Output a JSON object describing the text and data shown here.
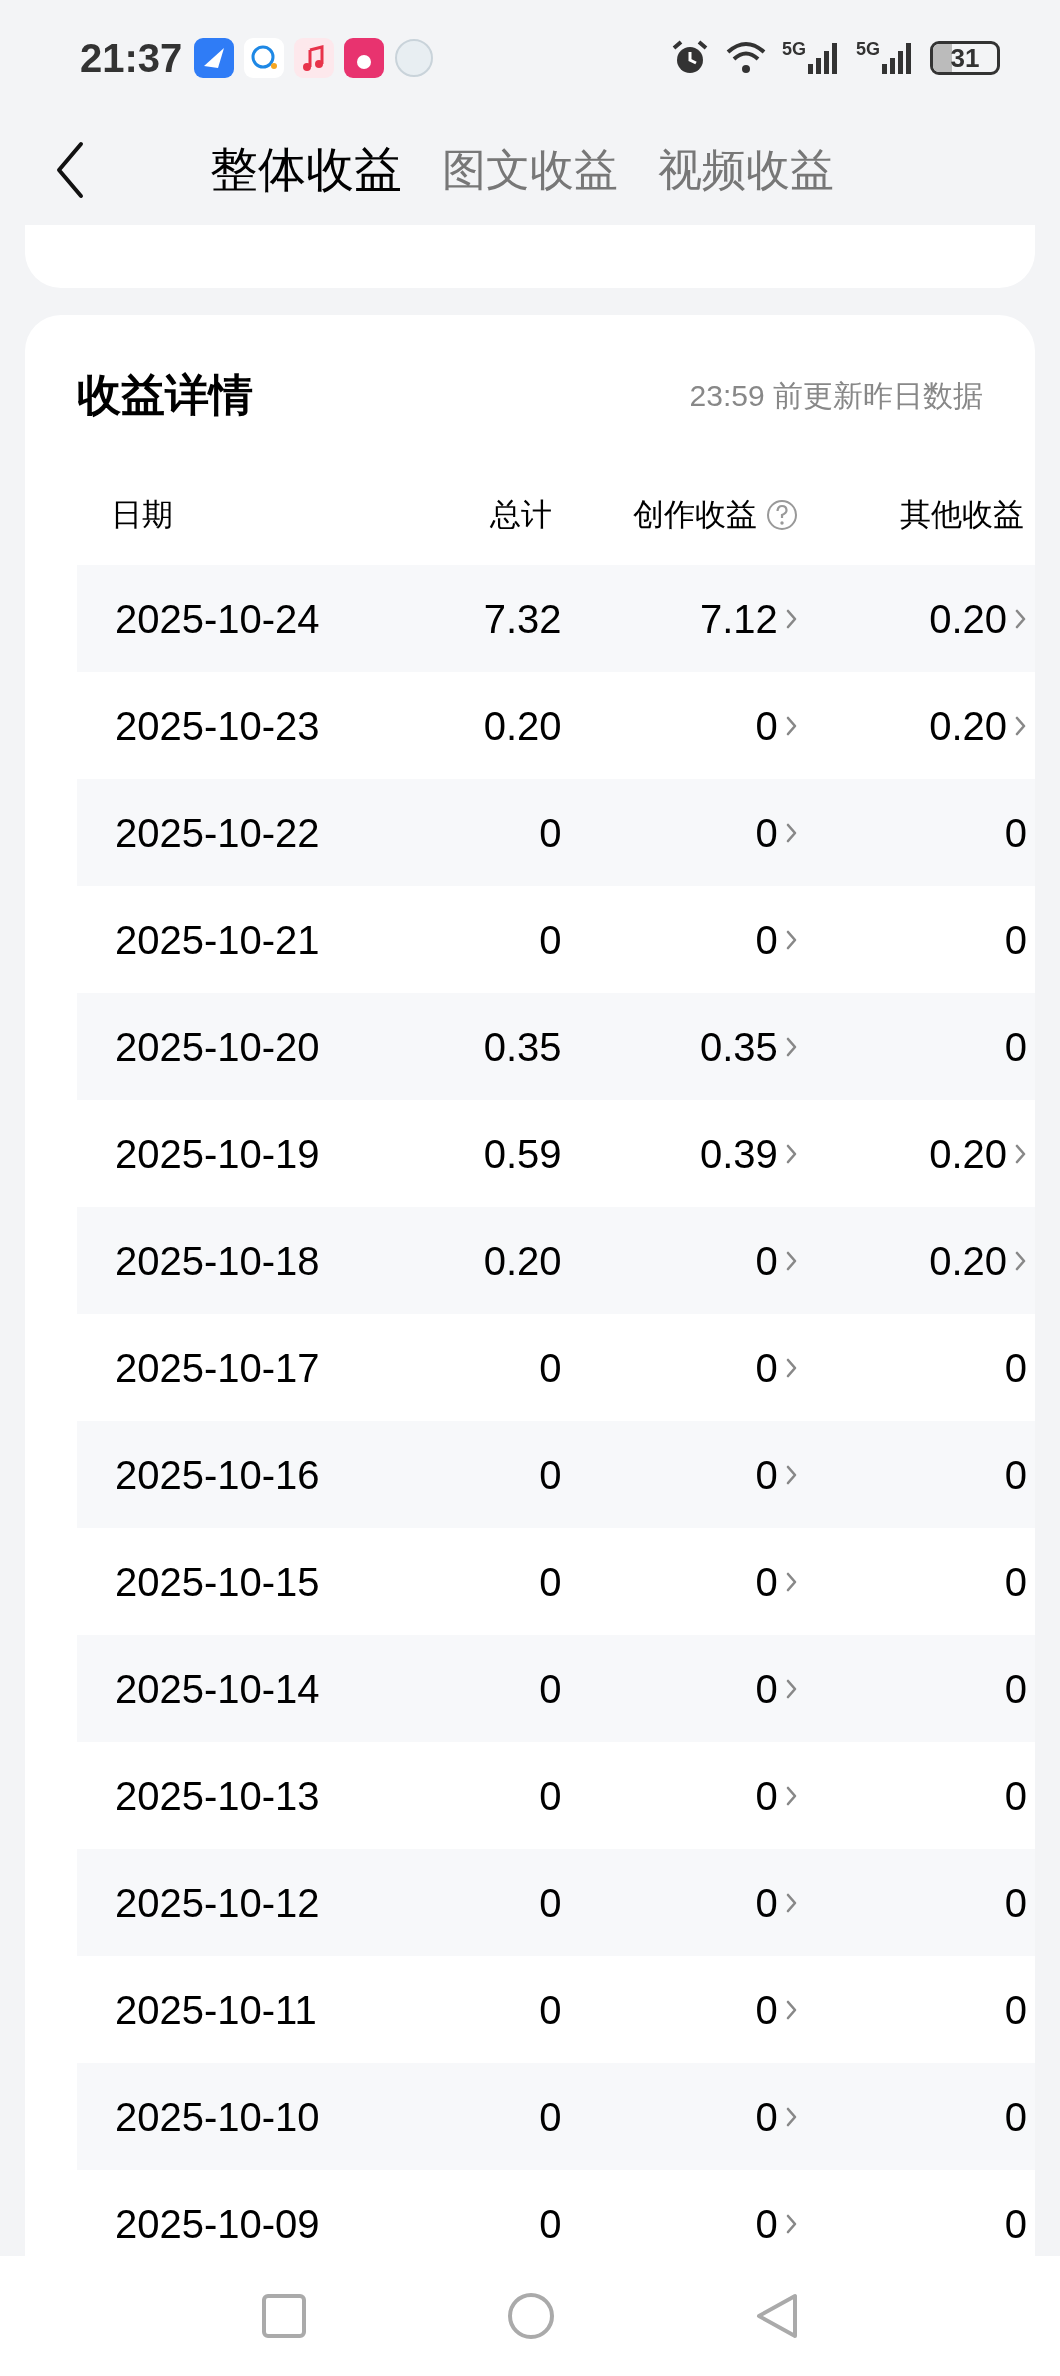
{
  "status_bar": {
    "time": "21:37",
    "networks": [
      {
        "label": "5G"
      },
      {
        "label": "5G"
      }
    ],
    "battery": "31"
  },
  "tabs": [
    {
      "label": "整体收益",
      "selected": true
    },
    {
      "label": "图文收益",
      "selected": false
    },
    {
      "label": "视频收益",
      "selected": false
    }
  ],
  "details": {
    "title": "收益详情",
    "note": "23:59 前更新昨日数据",
    "columns": [
      "日期",
      "总计",
      "创作收益",
      "其他收益"
    ],
    "rows": [
      {
        "date": "2025-10-24",
        "total": "7.32",
        "creation": "7.12",
        "other": "0.20",
        "other_link": true
      },
      {
        "date": "2025-10-23",
        "total": "0.20",
        "creation": "0",
        "other": "0.20",
        "other_link": true
      },
      {
        "date": "2025-10-22",
        "total": "0",
        "creation": "0",
        "other": "0",
        "other_link": false
      },
      {
        "date": "2025-10-21",
        "total": "0",
        "creation": "0",
        "other": "0",
        "other_link": false
      },
      {
        "date": "2025-10-20",
        "total": "0.35",
        "creation": "0.35",
        "other": "0",
        "other_link": false
      },
      {
        "date": "2025-10-19",
        "total": "0.59",
        "creation": "0.39",
        "other": "0.20",
        "other_link": true
      },
      {
        "date": "2025-10-18",
        "total": "0.20",
        "creation": "0",
        "other": "0.20",
        "other_link": true
      },
      {
        "date": "2025-10-17",
        "total": "0",
        "creation": "0",
        "other": "0",
        "other_link": false
      },
      {
        "date": "2025-10-16",
        "total": "0",
        "creation": "0",
        "other": "0",
        "other_link": false
      },
      {
        "date": "2025-10-15",
        "total": "0",
        "creation": "0",
        "other": "0",
        "other_link": false
      },
      {
        "date": "2025-10-14",
        "total": "0",
        "creation": "0",
        "other": "0",
        "other_link": false
      },
      {
        "date": "2025-10-13",
        "total": "0",
        "creation": "0",
        "other": "0",
        "other_link": false
      },
      {
        "date": "2025-10-12",
        "total": "0",
        "creation": "0",
        "other": "0",
        "other_link": false
      },
      {
        "date": "2025-10-11",
        "total": "0",
        "creation": "0",
        "other": "0",
        "other_link": false
      },
      {
        "date": "2025-10-10",
        "total": "0",
        "creation": "0",
        "other": "0",
        "other_link": false
      },
      {
        "date": "2025-10-09",
        "total": "0",
        "creation": "0",
        "other": "0",
        "other_link": false
      }
    ]
  }
}
